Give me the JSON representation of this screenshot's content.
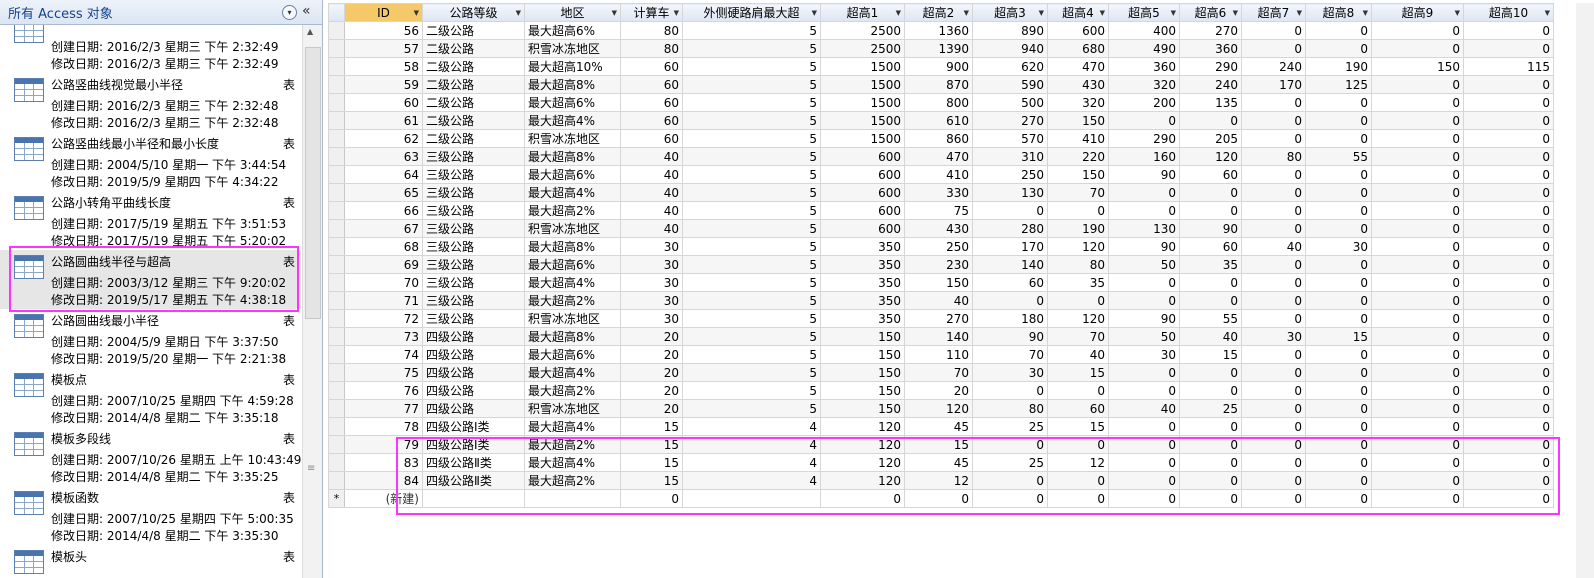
{
  "nav": {
    "title": "所有 Access 对象",
    "items": [
      {
        "name": "",
        "type": "",
        "created": "创建日期: 2016/2/3 星期三 下午 2:32:49",
        "modified": "修改日期: 2016/2/3 星期三 下午 2:32:49"
      },
      {
        "name": "公路竖曲线视觉最小半径",
        "type": "表",
        "created": "创建日期: 2016/2/3 星期三 下午 2:32:48",
        "modified": "修改日期: 2016/2/3 星期三 下午 2:32:48"
      },
      {
        "name": "公路竖曲线最小半径和最小长度",
        "type": "表",
        "created": "创建日期: 2004/5/10 星期一 下午 3:44:54",
        "modified": "修改日期: 2019/5/9 星期四 下午 4:34:22"
      },
      {
        "name": "公路小转角平曲线长度",
        "type": "表",
        "created": "创建日期: 2017/5/19 星期五 下午 3:51:53",
        "modified": "修改日期: 2017/5/19 星期五 下午 5:20:02"
      },
      {
        "name": "公路圆曲线半径与超高",
        "type": "表",
        "created": "创建日期: 2003/3/12 星期三 下午 9:20:02",
        "modified": "修改日期: 2019/5/17 星期五 下午 4:38:18"
      },
      {
        "name": "公路圆曲线最小半径",
        "type": "表",
        "created": "创建日期: 2004/5/9 星期日 下午 3:37:50",
        "modified": "修改日期: 2019/5/20 星期一 下午 2:21:38"
      },
      {
        "name": "模板点",
        "type": "表",
        "created": "创建日期: 2007/10/25 星期四 下午 4:59:28",
        "modified": "修改日期: 2014/4/8 星期二 下午 3:35:18"
      },
      {
        "name": "模板多段线",
        "type": "表",
        "created": "创建日期: 2007/10/26 星期五 上午 10:43:49",
        "modified": "修改日期: 2014/4/8 星期二 下午 3:35:25"
      },
      {
        "name": "模板函数",
        "type": "表",
        "created": "创建日期: 2007/10/25 星期四 下午 5:00:35",
        "modified": "修改日期: 2014/4/8 星期二 下午 3:35:30"
      },
      {
        "name": "模板头",
        "type": "表",
        "created": "",
        "modified": ""
      }
    ]
  },
  "grid": {
    "headers": [
      "ID",
      "公路等级",
      "地区",
      "计算车",
      "外侧硬路肩最大超",
      "超高1",
      "超高2",
      "超高3",
      "超高4",
      "超高5",
      "超高6",
      "超高7",
      "超高8",
      "超高9",
      "超高10"
    ],
    "rows": [
      [
        "56",
        "二级公路",
        "最大超高6%",
        "80",
        "5",
        "2500",
        "1360",
        "890",
        "600",
        "400",
        "270",
        "0",
        "0",
        "0",
        "0"
      ],
      [
        "57",
        "二级公路",
        "积雪冰冻地区",
        "80",
        "5",
        "2500",
        "1390",
        "940",
        "680",
        "490",
        "360",
        "0",
        "0",
        "0",
        "0"
      ],
      [
        "58",
        "二级公路",
        "最大超高10%",
        "60",
        "5",
        "1500",
        "900",
        "620",
        "470",
        "360",
        "290",
        "240",
        "190",
        "150",
        "115"
      ],
      [
        "59",
        "二级公路",
        "最大超高8%",
        "60",
        "5",
        "1500",
        "870",
        "590",
        "430",
        "320",
        "240",
        "170",
        "125",
        "0",
        "0"
      ],
      [
        "60",
        "二级公路",
        "最大超高6%",
        "60",
        "5",
        "1500",
        "800",
        "500",
        "320",
        "200",
        "135",
        "0",
        "0",
        "0",
        "0"
      ],
      [
        "61",
        "二级公路",
        "最大超高4%",
        "60",
        "5",
        "1500",
        "610",
        "270",
        "150",
        "0",
        "0",
        "0",
        "0",
        "0",
        "0"
      ],
      [
        "62",
        "二级公路",
        "积雪冰冻地区",
        "60",
        "5",
        "1500",
        "860",
        "570",
        "410",
        "290",
        "205",
        "0",
        "0",
        "0",
        "0"
      ],
      [
        "63",
        "三级公路",
        "最大超高8%",
        "40",
        "5",
        "600",
        "470",
        "310",
        "220",
        "160",
        "120",
        "80",
        "55",
        "0",
        "0"
      ],
      [
        "64",
        "三级公路",
        "最大超高6%",
        "40",
        "5",
        "600",
        "410",
        "250",
        "150",
        "90",
        "60",
        "0",
        "0",
        "0",
        "0"
      ],
      [
        "65",
        "三级公路",
        "最大超高4%",
        "40",
        "5",
        "600",
        "330",
        "130",
        "70",
        "0",
        "0",
        "0",
        "0",
        "0",
        "0"
      ],
      [
        "66",
        "三级公路",
        "最大超高2%",
        "40",
        "5",
        "600",
        "75",
        "0",
        "0",
        "0",
        "0",
        "0",
        "0",
        "0",
        "0"
      ],
      [
        "67",
        "三级公路",
        "积雪冰冻地区",
        "40",
        "5",
        "600",
        "430",
        "280",
        "190",
        "130",
        "90",
        "0",
        "0",
        "0",
        "0"
      ],
      [
        "68",
        "三级公路",
        "最大超高8%",
        "30",
        "5",
        "350",
        "250",
        "170",
        "120",
        "90",
        "60",
        "40",
        "30",
        "0",
        "0"
      ],
      [
        "69",
        "三级公路",
        "最大超高6%",
        "30",
        "5",
        "350",
        "230",
        "140",
        "80",
        "50",
        "35",
        "0",
        "0",
        "0",
        "0"
      ],
      [
        "70",
        "三级公路",
        "最大超高4%",
        "30",
        "5",
        "350",
        "150",
        "60",
        "35",
        "0",
        "0",
        "0",
        "0",
        "0",
        "0"
      ],
      [
        "71",
        "三级公路",
        "最大超高2%",
        "30",
        "5",
        "350",
        "40",
        "0",
        "0",
        "0",
        "0",
        "0",
        "0",
        "0",
        "0"
      ],
      [
        "72",
        "三级公路",
        "积雪冰冻地区",
        "30",
        "5",
        "350",
        "270",
        "180",
        "120",
        "90",
        "55",
        "0",
        "0",
        "0",
        "0"
      ],
      [
        "73",
        "四级公路",
        "最大超高8%",
        "20",
        "5",
        "150",
        "140",
        "90",
        "70",
        "50",
        "40",
        "30",
        "15",
        "0",
        "0"
      ],
      [
        "74",
        "四级公路",
        "最大超高6%",
        "20",
        "5",
        "150",
        "110",
        "70",
        "40",
        "30",
        "15",
        "0",
        "0",
        "0",
        "0"
      ],
      [
        "75",
        "四级公路",
        "最大超高4%",
        "20",
        "5",
        "150",
        "70",
        "30",
        "15",
        "0",
        "0",
        "0",
        "0",
        "0",
        "0"
      ],
      [
        "76",
        "四级公路",
        "最大超高2%",
        "20",
        "5",
        "150",
        "20",
        "0",
        "0",
        "0",
        "0",
        "0",
        "0",
        "0",
        "0"
      ],
      [
        "77",
        "四级公路",
        "积雪冰冻地区",
        "20",
        "5",
        "150",
        "120",
        "80",
        "60",
        "40",
        "25",
        "0",
        "0",
        "0",
        "0"
      ],
      [
        "78",
        "四级公路Ⅰ类",
        "最大超高4%",
        "15",
        "4",
        "120",
        "45",
        "25",
        "15",
        "0",
        "0",
        "0",
        "0",
        "0",
        "0"
      ],
      [
        "79",
        "四级公路Ⅰ类",
        "最大超高2%",
        "15",
        "4",
        "120",
        "15",
        "0",
        "0",
        "0",
        "0",
        "0",
        "0",
        "0",
        "0"
      ],
      [
        "83",
        "四级公路Ⅱ类",
        "最大超高4%",
        "15",
        "4",
        "120",
        "45",
        "25",
        "12",
        "0",
        "0",
        "0",
        "0",
        "0",
        "0"
      ],
      [
        "84",
        "四级公路Ⅱ类",
        "最大超高2%",
        "15",
        "4",
        "120",
        "12",
        "0",
        "0",
        "0",
        "0",
        "0",
        "0",
        "0",
        "0"
      ]
    ],
    "new_row": {
      "marker": "*",
      "label": "(新建)",
      "values": [
        "",
        "",
        "0",
        "",
        "0",
        "0",
        "0",
        "0",
        "0",
        "0",
        "0",
        "0",
        "0",
        "0"
      ]
    }
  }
}
